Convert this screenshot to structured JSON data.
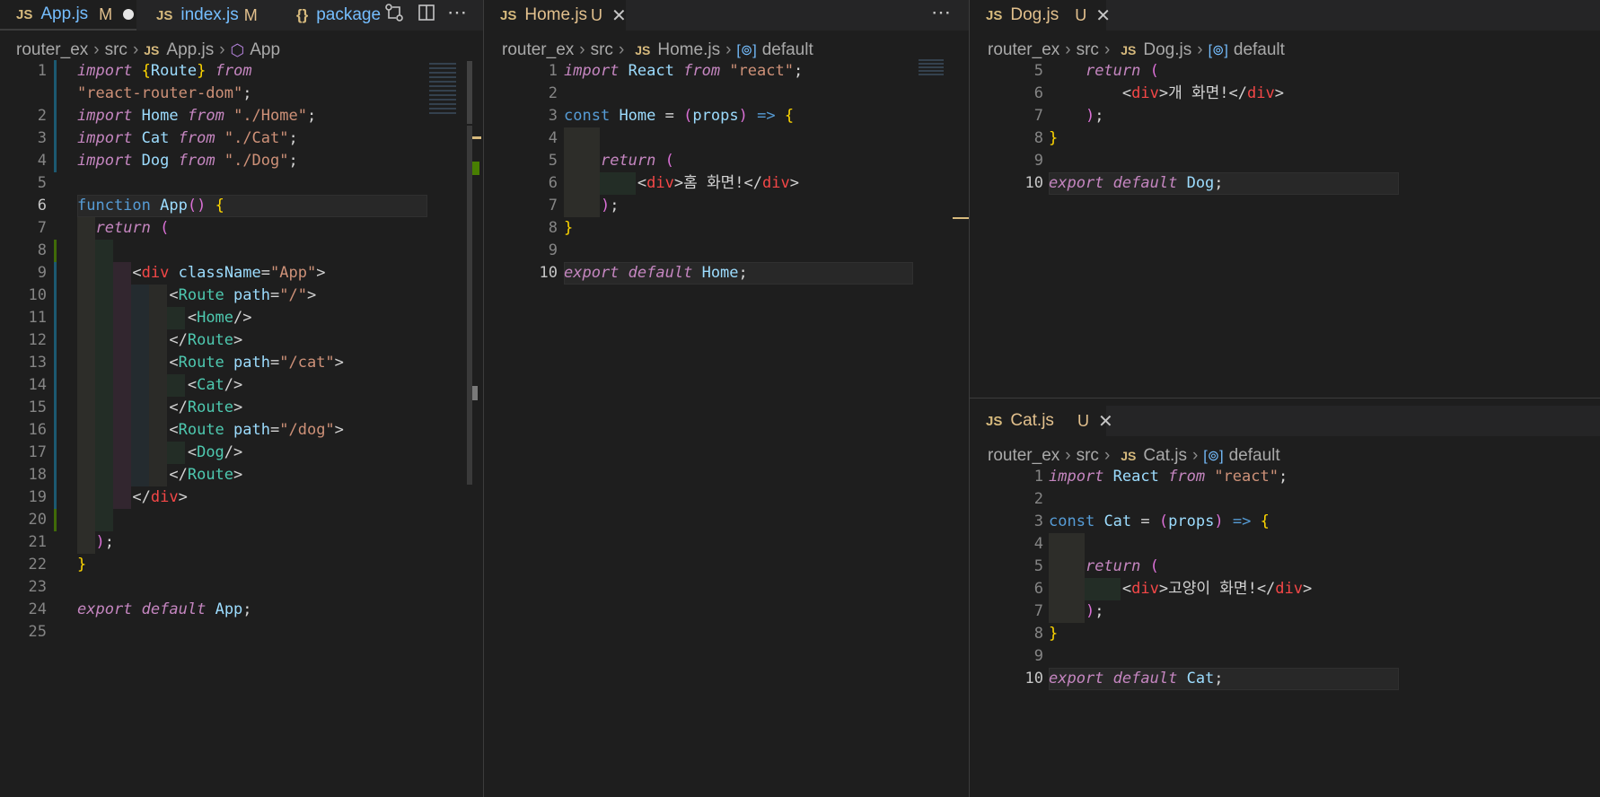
{
  "colors": {
    "background": "#1e1e1e",
    "tabbar": "#252526",
    "modified": "#e2c08d",
    "keyword": "#569cd6",
    "italic_keyword": "#c586c0",
    "string": "#ce9178",
    "jsx_tag": "#f44747",
    "component": "#4ec9b0",
    "variable": "#9cdcfe",
    "function": "#dcdcaa"
  },
  "icons": [
    "js-file-icon",
    "json-file-icon",
    "open-changes-icon",
    "split-editor-icon",
    "more-actions-icon",
    "close-icon",
    "component-icon",
    "variable-icon"
  ],
  "left": {
    "tabs": [
      {
        "label": "App.js",
        "badge": "M",
        "state": "unsaved"
      },
      {
        "label": "index.js",
        "badge": "M"
      },
      {
        "label": "package",
        "icon": "{}"
      }
    ],
    "crumbs": [
      "router_ex",
      "src",
      "App.js",
      "App"
    ],
    "lines": [
      {
        "n": "1",
        "t": "import {Route} from"
      },
      {
        "n": "",
        "t": "\"react-router-dom\";"
      },
      {
        "n": "2",
        "t": "import Home from \"./Home\";"
      },
      {
        "n": "3",
        "t": "import Cat from \"./Cat\";"
      },
      {
        "n": "4",
        "t": "import Dog from \"./Dog\";"
      },
      {
        "n": "5",
        "t": ""
      },
      {
        "n": "6",
        "t": "function App() {"
      },
      {
        "n": "7",
        "t": "  return ("
      },
      {
        "n": "8",
        "t": ""
      },
      {
        "n": "9",
        "t": "      <div className=\"App\">"
      },
      {
        "n": "10",
        "t": "          <Route path=\"/\">"
      },
      {
        "n": "11",
        "t": "            <Home/>"
      },
      {
        "n": "12",
        "t": "          </Route>"
      },
      {
        "n": "13",
        "t": "          <Route path=\"/cat\">"
      },
      {
        "n": "14",
        "t": "            <Cat/>"
      },
      {
        "n": "15",
        "t": "          </Route>"
      },
      {
        "n": "16",
        "t": "          <Route path=\"/dog\">"
      },
      {
        "n": "17",
        "t": "            <Dog/>"
      },
      {
        "n": "18",
        "t": "          </Route>"
      },
      {
        "n": "19",
        "t": "      </div>"
      },
      {
        "n": "20",
        "t": ""
      },
      {
        "n": "21",
        "t": "  );"
      },
      {
        "n": "22",
        "t": "}"
      },
      {
        "n": "23",
        "t": ""
      },
      {
        "n": "24",
        "t": "export default App;"
      },
      {
        "n": "25",
        "t": ""
      }
    ]
  },
  "middle": {
    "tabs": [
      {
        "label": "Home.js",
        "badge": "U"
      }
    ],
    "crumbs": [
      "router_ex",
      "src",
      "Home.js",
      "default"
    ],
    "lines": [
      {
        "n": "1",
        "t": "import React from \"react\";"
      },
      {
        "n": "2",
        "t": ""
      },
      {
        "n": "3",
        "t": "const Home = (props) => {"
      },
      {
        "n": "4",
        "t": ""
      },
      {
        "n": "5",
        "t": "    return ("
      },
      {
        "n": "6",
        "t": "        <div>홈 화면!</div>"
      },
      {
        "n": "7",
        "t": "    );"
      },
      {
        "n": "8",
        "t": "}"
      },
      {
        "n": "9",
        "t": ""
      },
      {
        "n": "10",
        "t": "export default Home;"
      }
    ]
  },
  "topright": {
    "tabs": [
      {
        "label": "Dog.js",
        "badge": "U"
      }
    ],
    "crumbs": [
      "router_ex",
      "src",
      "Dog.js",
      "default"
    ],
    "lines": [
      {
        "n": "5",
        "t": "    return ("
      },
      {
        "n": "6",
        "t": "        <div>개 화면!</div>"
      },
      {
        "n": "7",
        "t": "    );"
      },
      {
        "n": "8",
        "t": "}"
      },
      {
        "n": "9",
        "t": ""
      },
      {
        "n": "10",
        "t": "export default Dog;"
      }
    ]
  },
  "bottomright": {
    "tabs": [
      {
        "label": "Cat.js",
        "badge": "U"
      }
    ],
    "crumbs": [
      "router_ex",
      "src",
      "Cat.js",
      "default"
    ],
    "lines": [
      {
        "n": "1",
        "t": "import React from \"react\";"
      },
      {
        "n": "2",
        "t": ""
      },
      {
        "n": "3",
        "t": "const Cat = (props) => {"
      },
      {
        "n": "4",
        "t": ""
      },
      {
        "n": "5",
        "t": "    return ("
      },
      {
        "n": "6",
        "t": "        <div>고양이 화면!</div>"
      },
      {
        "n": "7",
        "t": "    );"
      },
      {
        "n": "8",
        "t": "}"
      },
      {
        "n": "9",
        "t": ""
      },
      {
        "n": "10",
        "t": "export default Cat;"
      }
    ]
  }
}
